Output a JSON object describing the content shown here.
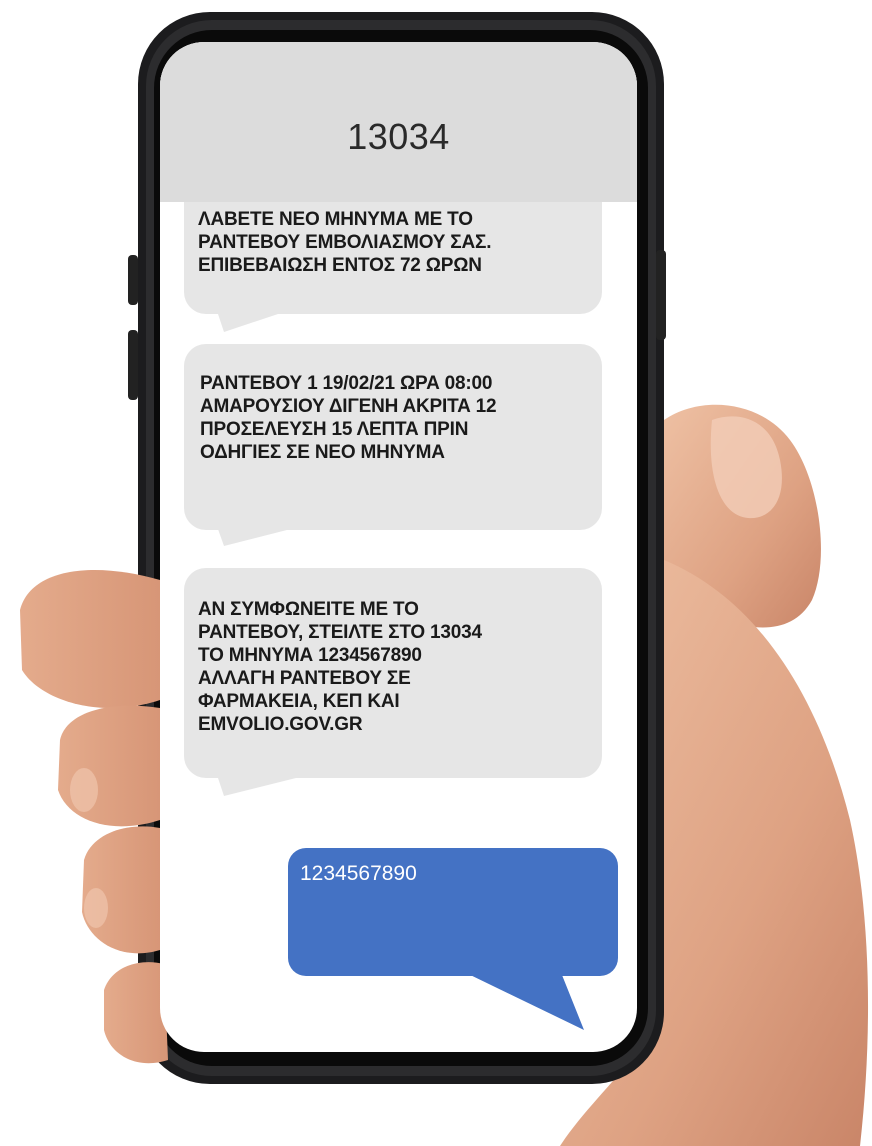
{
  "conversation": {
    "contact": "13034",
    "messages": [
      {
        "direction": "incoming",
        "text": "ΛΑΒΕΤΕ ΝΕΟ ΜΗΝΥΜΑ  ΜΕ ΤΟ\nΡΑΝΤΕΒΟΥ ΕΜΒΟΛΙΑΣΜΟΥ ΣΑΣ.\nΕΠΙΒΕΒΑΙΩΣΗ ΕΝΤΟΣ 72 ΩΡΩΝ"
      },
      {
        "direction": "incoming",
        "text": " ΡΑΝΤΕΒΟΥ 1 19/02/21 ΩΡΑ 08:00\nΑΜΑΡΟΥΣΙΟΥ ΔΙΓΕΝΗ ΑΚΡΙΤΑ 12\nΠΡΟΣΕΛΕΥΣΗ 15 ΛΕΠΤΑ ΠΡΙΝ\nΟΔΗΓΙΕΣ ΣΕ ΝΕΟ ΜΗΝΥΜΑ"
      },
      {
        "direction": "incoming",
        "text": "ΑΝ ΣΥΜΦΩΝΕΙΤΕ ΜΕ ΤΟ\nΡΑΝΤΕΒΟΥ, ΣΤΕΙΛΤΕ ΣΤΟ 13034\nΤΟ ΜΗΝΥΜΑ  1234567890\nΑΛΛΑΓΗ ΡΑΝΤΕΒΟΥ ΣΕ\nΦΑΡΜΑΚΕΙΑ, ΚΕΠ ΚΑΙ\nEMVOLIO.GOV.GR"
      },
      {
        "direction": "outgoing",
        "text": "1234567890"
      }
    ]
  },
  "colors": {
    "header": "#dcdcdc",
    "incoming_bubble": "#e6e6e6",
    "outgoing_bubble": "#4472c4",
    "phone_frame": "#1c1c1e",
    "skin": "#e0a98a"
  }
}
